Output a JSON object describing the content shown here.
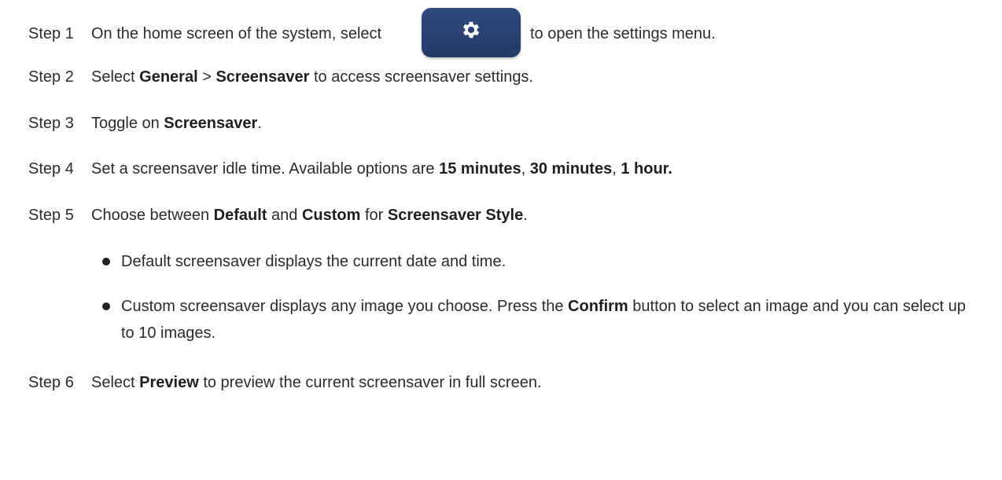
{
  "steps": [
    {
      "num": "Step 1",
      "pre": "On the home screen of the system, select",
      "post": "to open the settings menu.",
      "icon": "gear-icon"
    },
    {
      "num": "Step 2",
      "t1": "Select ",
      "b1": "General",
      "t2": " > ",
      "b2": "Screensaver",
      "t3": " to access screensaver settings."
    },
    {
      "num": "Step 3",
      "t1": "Toggle on ",
      "b1": "Screensaver",
      "t2": "."
    },
    {
      "num": "Step 4",
      "t1": "Set a screensaver idle time. Available options are ",
      "b1": "15 minutes",
      "t2": ", ",
      "b2": "30 minutes",
      "t3": ", ",
      "b3": "1 hour."
    },
    {
      "num": "Step 5",
      "t1": "Choose between ",
      "b1": "Default",
      "t2": " and ",
      "b2": "Custom",
      "t3": " for ",
      "b3": "Screensaver Style",
      "t4": "."
    },
    {
      "num": "Step 6",
      "t1": "Select ",
      "b1": "Preview",
      "t2": " to preview the current screensaver in full screen."
    }
  ],
  "bullets": [
    {
      "t1": "Default screensaver displays the current date and time."
    },
    {
      "t1": "Custom screensaver displays any image you choose. Press the ",
      "b1": "Confirm",
      "t2": " button to select an image and you can select up to 10 images."
    }
  ],
  "colors": {
    "button_bg": "#2b4272",
    "text": "#2b2b2b"
  }
}
